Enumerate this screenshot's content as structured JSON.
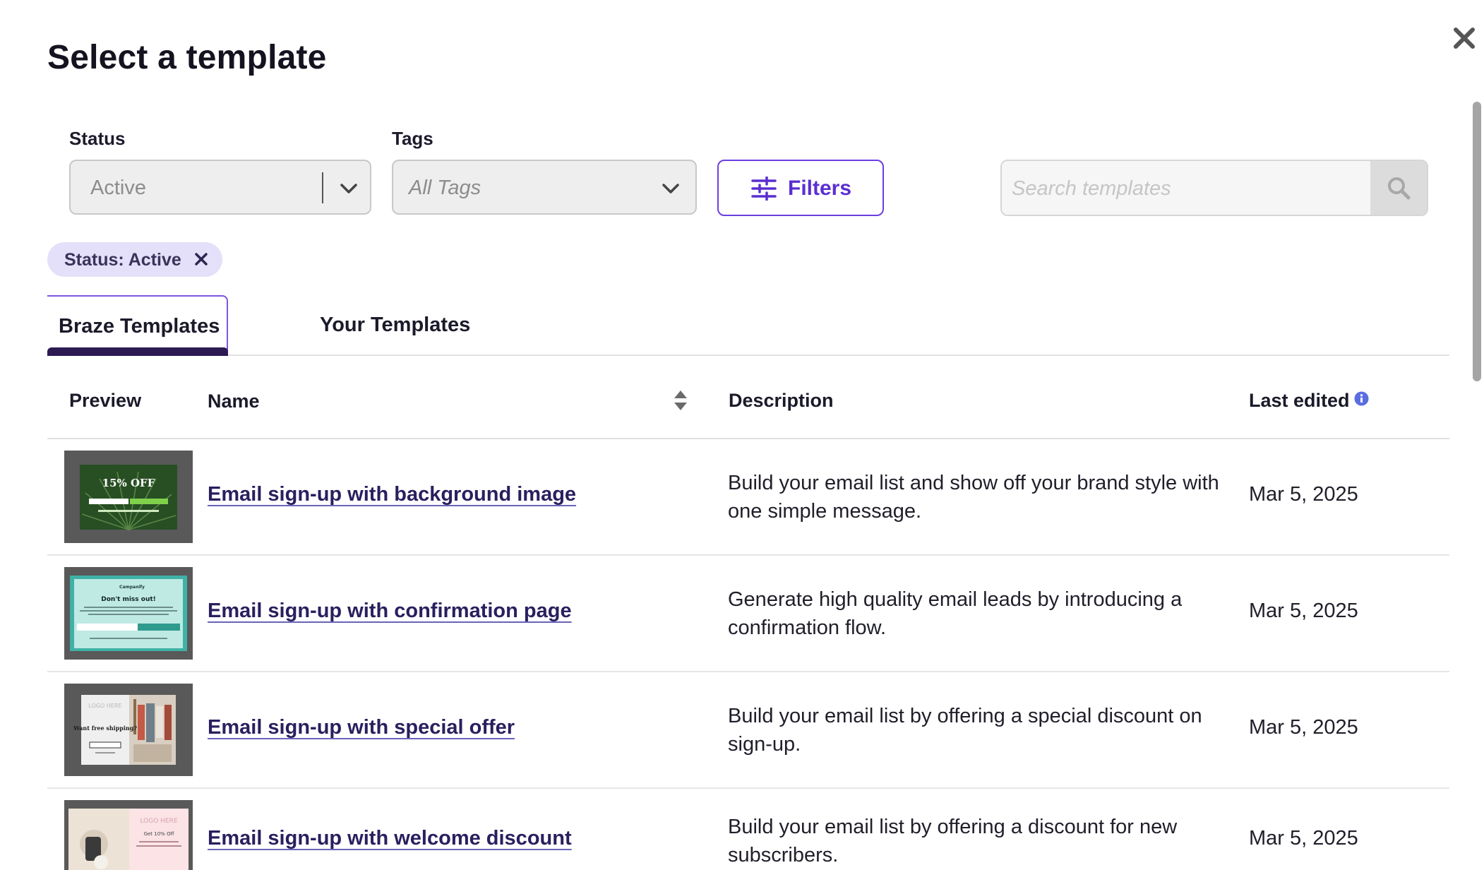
{
  "modal": {
    "title": "Select a template"
  },
  "filters": {
    "status_label": "Status",
    "status_value": "Active",
    "tags_label": "Tags",
    "tags_value": "All Tags",
    "filters_button": "Filters",
    "search_placeholder": "Search templates"
  },
  "active_chips": [
    {
      "label": "Status: Active"
    }
  ],
  "tabs": [
    {
      "label": "Braze Templates",
      "active": true
    },
    {
      "label": "Your Templates",
      "active": false
    }
  ],
  "table": {
    "columns": {
      "preview": "Preview",
      "name": "Name",
      "description": "Description",
      "last_edited": "Last edited"
    },
    "rows": [
      {
        "name": "Email sign-up with background image",
        "description": "Build your email list and show off your brand style with one simple message.",
        "last_edited": "Mar 5, 2025",
        "thumb_text": "15% OFF"
      },
      {
        "name": "Email sign-up with confirmation page",
        "description": "Generate high quality email leads by introducing a confirmation flow.",
        "last_edited": "Mar 5, 2025",
        "thumb_text": "Don't miss out!",
        "thumb_brand": "Campanify"
      },
      {
        "name": "Email sign-up with special offer",
        "description": "Build your email list by offering a special discount on sign-up.",
        "last_edited": "Mar 5, 2025",
        "thumb_text": "Want free shipping?",
        "thumb_logo": "LOGO HERE"
      },
      {
        "name": "Email sign-up with welcome discount",
        "description": "Build your email list by offering a discount for new subscribers.",
        "last_edited": "Mar 5, 2025",
        "thumb_text": "Get 10% Off",
        "thumb_logo": "LOGO HERE"
      }
    ]
  },
  "colors": {
    "accent": "#6b3fe0",
    "tab_underline": "#2d1a52",
    "chip_bg": "#e4e0fa",
    "link": "#2a1f5e"
  }
}
